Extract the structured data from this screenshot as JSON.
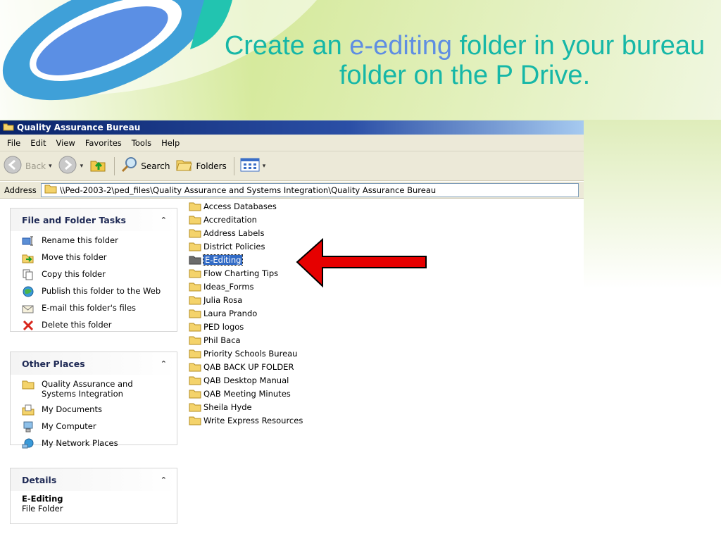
{
  "slide": {
    "title_part1": "Create an ",
    "title_accent": "e-editing",
    "title_part2": " folder in your bureau folder on the P Drive.",
    "colors": {
      "title": "#16b7a7",
      "accent": "#5f8ee2",
      "arrow": "#e60000"
    }
  },
  "window": {
    "title": "Quality Assurance Bureau",
    "menu": [
      "File",
      "Edit",
      "View",
      "Favorites",
      "Tools",
      "Help"
    ],
    "toolbar": {
      "back_label": "Back",
      "search_label": "Search",
      "folders_label": "Folders"
    },
    "address": {
      "label": "Address",
      "path": "\\\\Ped-2003-2\\ped_files\\Quality Assurance and Systems Integration\\Quality Assurance Bureau"
    }
  },
  "taskpane": {
    "file_tasks": {
      "title": "File and Folder Tasks",
      "items": [
        {
          "label": "Rename this folder",
          "icon": "rename-icon"
        },
        {
          "label": "Move this folder",
          "icon": "move-icon"
        },
        {
          "label": "Copy this folder",
          "icon": "copy-icon"
        },
        {
          "label": "Publish this folder to the Web",
          "icon": "publish-web-icon"
        },
        {
          "label": "E-mail this folder's files",
          "icon": "email-icon"
        },
        {
          "label": "Delete this folder",
          "icon": "delete-icon"
        }
      ]
    },
    "other_places": {
      "title": "Other Places",
      "items": [
        {
          "label": "Quality Assurance and Systems Integration",
          "icon": "folder-icon"
        },
        {
          "label": "My Documents",
          "icon": "my-documents-icon"
        },
        {
          "label": "My Computer",
          "icon": "my-computer-icon"
        },
        {
          "label": "My Network Places",
          "icon": "network-places-icon"
        }
      ]
    },
    "details": {
      "title": "Details",
      "name": "E-Editing",
      "type": "File Folder"
    }
  },
  "files": [
    "Access Databases",
    "Accreditation",
    "Address Labels",
    "District Policies",
    "E-Editing",
    "Flow Charting Tips",
    "Ideas_Forms",
    "Julia Rosa",
    "Laura Prando",
    "PED logos",
    "Phil Baca",
    "Priority Schools Bureau",
    "QAB BACK UP FOLDER",
    "QAB Desktop Manual",
    "QAB Meeting Minutes",
    "Sheila Hyde",
    "Write Express Resources"
  ],
  "selected_file": "E-Editing"
}
